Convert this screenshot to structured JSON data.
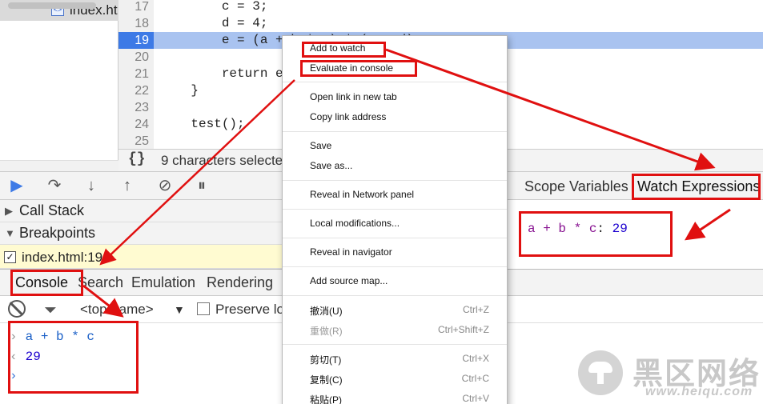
{
  "file_tree": {
    "selected_file": "index.ht"
  },
  "editor": {
    "lines": [
      {
        "number": "17",
        "code": "        c = 3;"
      },
      {
        "number": "18",
        "code": "        d = 4;"
      },
      {
        "number": "19",
        "code": "        e = (a + b * c) * (c + d);"
      },
      {
        "number": "20",
        "code": ""
      },
      {
        "number": "21",
        "code": "        return e"
      },
      {
        "number": "22",
        "code": "    }"
      },
      {
        "number": "23",
        "code": ""
      },
      {
        "number": "24",
        "code": "    test();"
      },
      {
        "number": "25",
        "code": ""
      }
    ],
    "status_text": "9 characters selecte"
  },
  "sidebar": {
    "call_stack": "Call Stack",
    "breakpoints": "Breakpoints",
    "breakpoint_item": "index.html:19"
  },
  "right_panel": {
    "tab_scope": "Scope Variables",
    "tab_watch": "Watch Expressions",
    "watch_name": "a + b * c",
    "watch_value": "29"
  },
  "drawer": {
    "tabs": [
      "Console",
      "Search",
      "Emulation",
      "Rendering"
    ],
    "frame": "<top frame>",
    "preserve_log": "Preserve lo",
    "input": "a + b * c",
    "result": "29"
  },
  "context_menu": {
    "items": [
      {
        "label": "Add to watch",
        "shortcut": "",
        "disabled": false
      },
      {
        "label": "Evaluate in console",
        "shortcut": "",
        "disabled": false
      },
      {
        "label": "Open link in new tab",
        "shortcut": "",
        "disabled": false
      },
      {
        "label": "Copy link address",
        "shortcut": "",
        "disabled": false
      },
      {
        "label": "Save",
        "shortcut": "",
        "disabled": false
      },
      {
        "label": "Save as...",
        "shortcut": "",
        "disabled": false
      },
      {
        "label": "Reveal in Network panel",
        "shortcut": "",
        "disabled": false
      },
      {
        "label": "Local modifications...",
        "shortcut": "",
        "disabled": false
      },
      {
        "label": "Reveal in navigator",
        "shortcut": "",
        "disabled": false
      },
      {
        "label": "Add source map...",
        "shortcut": "",
        "disabled": false
      },
      {
        "label": "撤消(U)",
        "shortcut": "Ctrl+Z",
        "disabled": false
      },
      {
        "label": "重做(R)",
        "shortcut": "Ctrl+Shift+Z",
        "disabled": true
      },
      {
        "label": "剪切(T)",
        "shortcut": "Ctrl+X",
        "disabled": false
      },
      {
        "label": "复制(C)",
        "shortcut": "Ctrl+C",
        "disabled": false
      },
      {
        "label": "粘贴(P)",
        "shortcut": "Ctrl+V",
        "disabled": false
      }
    ]
  },
  "watermark": {
    "name": "黑区网络",
    "url": "www.heiqu.com"
  },
  "colors": {
    "annotation_red": "#e01010",
    "execution_line": "#a9c3f0",
    "gutter_active": "#3d7ae6"
  }
}
